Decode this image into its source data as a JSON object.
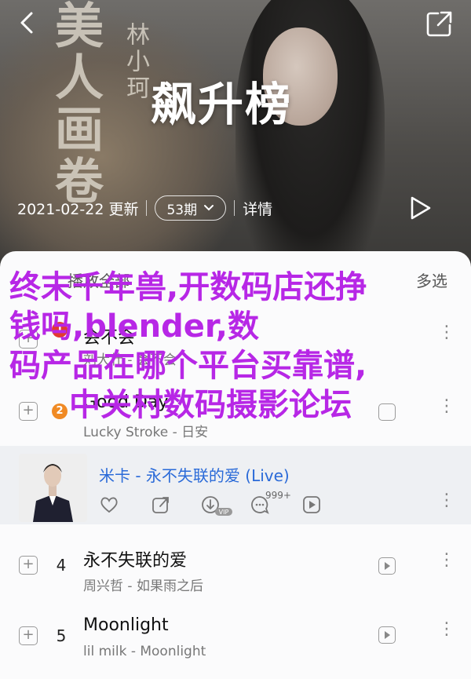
{
  "header": {
    "title": "飙升榜",
    "update_date": "2021-02-22 更新",
    "comment_count": "53期",
    "detail_label": "详情",
    "calligraphy_big": "美人画卷",
    "calligraphy_small": "林小珂"
  },
  "sheet": {
    "play_all_label": "播放全部",
    "multi_select_label": "多选"
  },
  "rows": [
    {
      "rank": "1",
      "song": "会不会",
      "artist": "刘大壮 - 会不会",
      "badge": "1"
    },
    {
      "rank": "2",
      "song": "Good Day",
      "artist": "Lucky Stroke - 日安",
      "badge": "2"
    },
    {
      "song": "米卡 - 永不失联的爱 (Live)",
      "count": "999+"
    },
    {
      "rank": "4",
      "song": "永不失联的爱",
      "artist": "周兴哲 - 如果雨之后"
    },
    {
      "rank": "5",
      "song": "Moonlight",
      "artist": "lil milk - Moonlight"
    }
  ],
  "overlay": {
    "line1": "终末千年兽,开数码店还挣",
    "line2": "钱吗,blender,数",
    "line3": "码产品在哪个平台买靠谱,",
    "line4": "中关村数码摄影论坛"
  },
  "colors": {
    "overlay_text": "#b727e6",
    "highlight_title": "#2a6ad8",
    "badge_red": "#e23b2e",
    "badge_orange": "#f08a24"
  }
}
